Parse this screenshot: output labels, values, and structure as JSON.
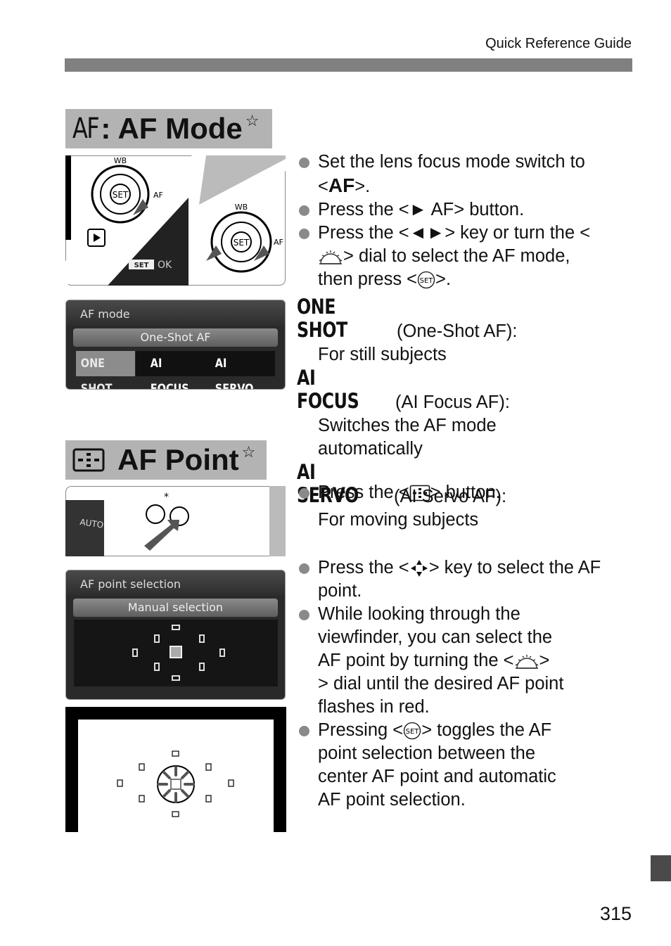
{
  "header": {
    "label": "Quick Reference Guide"
  },
  "section_af_mode": {
    "title_prefix": "AF",
    "title": ": AF Mode",
    "star": "☆",
    "camera_illustration": {
      "wb_label": "WB",
      "set_label": "SET",
      "af_label": "AF",
      "lcd_prompt_key": "SET",
      "lcd_prompt": "OK"
    },
    "lcd_screen": {
      "title": "AF mode",
      "current": "One-Shot AF",
      "options": [
        "ONE SHOT",
        "AI FOCUS",
        "AI SERVO"
      ],
      "selected_index": 0
    },
    "steps": [
      {
        "parts": [
          "Set the lens focus mode switch to <",
          "AF",
          ">."
        ]
      },
      {
        "parts": [
          "Press the <",
          "► AF",
          "> button."
        ]
      },
      {
        "parts": [
          "Press the <",
          "◄►",
          "> key or turn the <",
          "dial-icon",
          "> dial to select the AF mode, then press <",
          "set-icon",
          ">."
        ]
      }
    ],
    "modes": [
      {
        "name": "ONE SHOT",
        "label": "(One-Shot AF):",
        "description": "For still subjects"
      },
      {
        "name": "AI FOCUS",
        "label": "(AI Focus AF):",
        "description_lines": [
          "Switches the AF mode",
          "automatically"
        ]
      },
      {
        "name": "AI SERVO",
        "label": "(AI Servo AF):",
        "description": "For moving subjects"
      }
    ]
  },
  "section_af_point": {
    "title": "AF Point",
    "star": "☆",
    "lcd_screen": {
      "title": "AF point selection",
      "current": "Manual selection"
    },
    "steps": [
      {
        "parts": [
          "Press the <",
          "af-point-icon",
          "> button."
        ]
      },
      {
        "parts": [
          "Press the <",
          "cross-key-icon",
          "> key to select the AF point."
        ]
      },
      {
        "lines": [
          "While looking through the",
          "viewfinder, you can select the",
          "AF point by turning the <",
          "> dial until the desired AF point",
          "flashes in red."
        ]
      },
      {
        "lines": [
          "Pressing <",
          "> toggles the AF",
          "point selection between the",
          "center AF point and automatic",
          "AF point selection."
        ]
      }
    ]
  },
  "footer": {
    "page_number": "315"
  }
}
